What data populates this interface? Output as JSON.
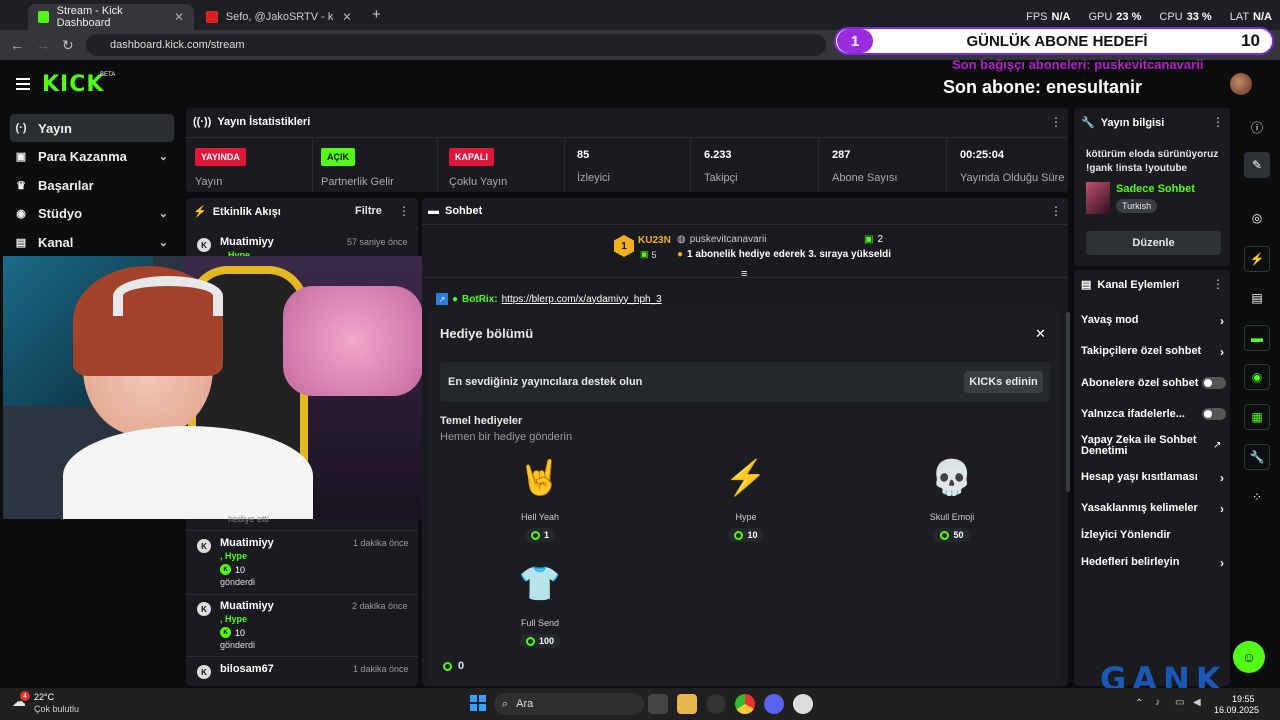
{
  "browser": {
    "tabs": [
      {
        "title": "Stream - Kick Dashboard",
        "active": true
      },
      {
        "title": "Sefo, @JakoSRTV - kördüğüm",
        "active": false
      }
    ],
    "url": "dashboard.kick.com/stream",
    "new_tab": "+"
  },
  "overlay": {
    "fps_label": "FPS",
    "fps_value": "N/A",
    "gpu_label": "GPU",
    "gpu_value": "23 %",
    "cpu_label": "CPU",
    "cpu_value": "33 %",
    "lat_label": "LAT",
    "lat_value": "N/A",
    "goal_number": "1",
    "goal_title": "GÜNLÜK ABONE HEDEFİ",
    "goal_count": "10",
    "last_donor": "Son bağışçı aboneleri: puskevitcanavarii",
    "last_sub": "Son abone: enesultanir",
    "watermark": "GANK"
  },
  "app": {
    "logo": "KICK",
    "beta": "BETA"
  },
  "sidebar": {
    "items": [
      {
        "label": "Yayın",
        "icon": "broadcast-icon",
        "glyph": "(·)"
      },
      {
        "label": "Para Kazanma",
        "icon": "money-icon",
        "glyph": "▣"
      },
      {
        "label": "Başarılar",
        "icon": "trophy-icon",
        "glyph": "🏆"
      },
      {
        "label": "Stüdyo",
        "icon": "studio-icon",
        "glyph": "◉"
      },
      {
        "label": "Kanal",
        "icon": "channel-icon",
        "glyph": "▤"
      }
    ]
  },
  "stats": {
    "title": "Yayın İstatistikleri",
    "cells": [
      {
        "badge": "YAYINDA",
        "badge_color": "#e0163b",
        "label": "Yayın"
      },
      {
        "badge": "AÇIK",
        "badge_color": "#53fc18",
        "label": "Partnerlik Gelir"
      },
      {
        "badge": "KAPALI",
        "badge_color": "#e0163b",
        "label": "Çoklu Yayın"
      },
      {
        "value": "85",
        "label": "İzleyici"
      },
      {
        "value": "6.233",
        "label": "Takipçi"
      },
      {
        "value": "287",
        "label": "Abone Sayısı"
      },
      {
        "value": "00:25:04",
        "label": "Yayında Olduğu Süre"
      }
    ]
  },
  "activity": {
    "title": "Etkinlik Akışı",
    "filter": "Filtre",
    "events": [
      {
        "name": "Muatimiyy",
        "time": "57 saniye önce",
        "gift": "Hype"
      },
      {
        "name": "Muatimiyy",
        "time": "1 dakika önce",
        "gift": ", Hype",
        "amount": "10",
        "sent": "gönderdi"
      },
      {
        "name": "Muatimiyy",
        "time": "2 dakika önce",
        "gift": ", Hype",
        "amount": "10",
        "sent": "gönderdi"
      },
      {
        "name": "bilosam67",
        "time": "1 dakika önce"
      }
    ],
    "partial": "hediye etti"
  },
  "chat": {
    "title": "Sohbet",
    "leader": {
      "rank": "1",
      "name": "KU23N",
      "count": "5"
    },
    "pinned": {
      "user": "puskevitcanavarii",
      "count": "2",
      "msg": "1 abonelik hediye ederek 3. sıraya yükseldi"
    },
    "bot": {
      "name": "BotRix:",
      "link": "https://blerp.com/x/aydamiyy_hph_3"
    },
    "gift_section": {
      "title": "Hediye bölümü",
      "support": "En sevdiğiniz yayıncılara destek olun",
      "kicks_btn": "KICKs edinin",
      "basic": "Temel hediyeler",
      "basic_sub": "Hemen bir hediye gönderin",
      "gifts": [
        {
          "name": "Hell Yeah",
          "price": "1",
          "emoji": "🤘"
        },
        {
          "name": "Hype",
          "price": "10",
          "emoji": "⚡"
        },
        {
          "name": "Skull Emoji",
          "price": "50",
          "emoji": "💀"
        },
        {
          "name": "Full Send",
          "price": "100",
          "emoji": "👕"
        }
      ],
      "balance": "0"
    }
  },
  "info": {
    "title": "Yayın bilgisi",
    "stream_title": "kötürüm eloda sürünüyoruz !gank !insta !youtube",
    "category": "Sadece Sohbet",
    "language": "Turkish",
    "edit": "Düzenle"
  },
  "actions": {
    "title": "Kanal Eylemleri",
    "items": [
      {
        "label": "Yavaş mod",
        "type": "chev"
      },
      {
        "label": "Takipçilere özel sohbet",
        "type": "chev"
      },
      {
        "label": "Abonelere özel sohbet",
        "type": "toggle"
      },
      {
        "label": "Yalnızca ifadelerle...",
        "type": "toggle"
      },
      {
        "label": "Yapay Zeka ile Sohbet Denetimi",
        "type": "ext"
      },
      {
        "label": "Hesap yaşı kısıtlaması",
        "type": "chev"
      },
      {
        "label": "Yasaklanmış kelimeler",
        "type": "chev"
      },
      {
        "label": "İzleyici Yönlendir",
        "type": "none"
      },
      {
        "label": "Hedefleri belirleyin",
        "type": "chev"
      }
    ]
  },
  "taskbar": {
    "weather_temp": "22°C",
    "weather_desc": "Çok bulutlu",
    "weather_badge": "4",
    "search": "Ara",
    "time": "19:55",
    "date": "16.09.2025"
  }
}
